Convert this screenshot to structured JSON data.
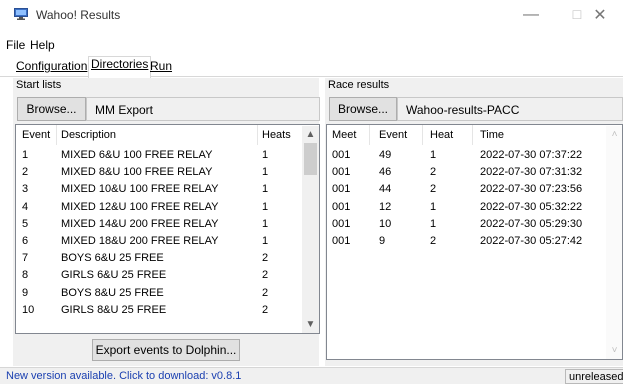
{
  "window": {
    "title": "Wahoo! Results",
    "min_glyph": "—",
    "max_glyph": "☐",
    "close_glyph": "✕"
  },
  "menu": [
    {
      "label": "File"
    },
    {
      "label": "Help"
    }
  ],
  "tabs": [
    {
      "label": "Configuration"
    },
    {
      "label": "Directories"
    },
    {
      "label": "Run"
    }
  ],
  "start_lists": {
    "group_label": "Start lists",
    "browse_label": "Browse...",
    "path": "MM Export",
    "columns": [
      "Event",
      "Description",
      "Heats"
    ],
    "rows": [
      [
        "1",
        "MIXED 6&U 100 FREE RELAY",
        "1"
      ],
      [
        "2",
        "MIXED 8&U 100 FREE RELAY",
        "1"
      ],
      [
        "3",
        "MIXED 10&U 100 FREE RELAY",
        "1"
      ],
      [
        "4",
        "MIXED 12&U 100 FREE RELAY",
        "1"
      ],
      [
        "5",
        "MIXED 14&U 200 FREE RELAY",
        "1"
      ],
      [
        "6",
        "MIXED 18&U 200 FREE RELAY",
        "1"
      ],
      [
        "7",
        "BOYS 6&U 25 FREE",
        "2"
      ],
      [
        "8",
        "GIRLS 6&U 25 FREE",
        "2"
      ],
      [
        "9",
        "BOYS 8&U 25 FREE",
        "2"
      ],
      [
        "10",
        "GIRLS 8&U 25 FREE",
        "2"
      ]
    ],
    "export_label": "Export events to Dolphin..."
  },
  "race_results": {
    "group_label": "Race results",
    "browse_label": "Browse...",
    "path": "Wahoo-results-PACC",
    "columns": [
      "Meet",
      "Event",
      "Heat",
      "Time"
    ],
    "rows": [
      [
        "001",
        "49",
        "1",
        "2022-07-30 07:37:22"
      ],
      [
        "001",
        "46",
        "2",
        "2022-07-30 07:31:32"
      ],
      [
        "001",
        "44",
        "2",
        "2022-07-30 07:23:56"
      ],
      [
        "001",
        "12",
        "1",
        "2022-07-30 05:32:22"
      ],
      [
        "001",
        "10",
        "1",
        "2022-07-30 05:29:30"
      ],
      [
        "001",
        "9",
        "2",
        "2022-07-30 05:27:42"
      ]
    ]
  },
  "status": {
    "message": "New version available. Click to download: v0.8.1",
    "version": "unreleased"
  },
  "colors": {
    "link": "#1a3fb0",
    "panel": "#f0f0f0",
    "border": "#828790"
  },
  "icons": {
    "app": "monitor-icon",
    "scroll_up": "chevron-up-icon",
    "scroll_down": "chevron-down-icon"
  }
}
